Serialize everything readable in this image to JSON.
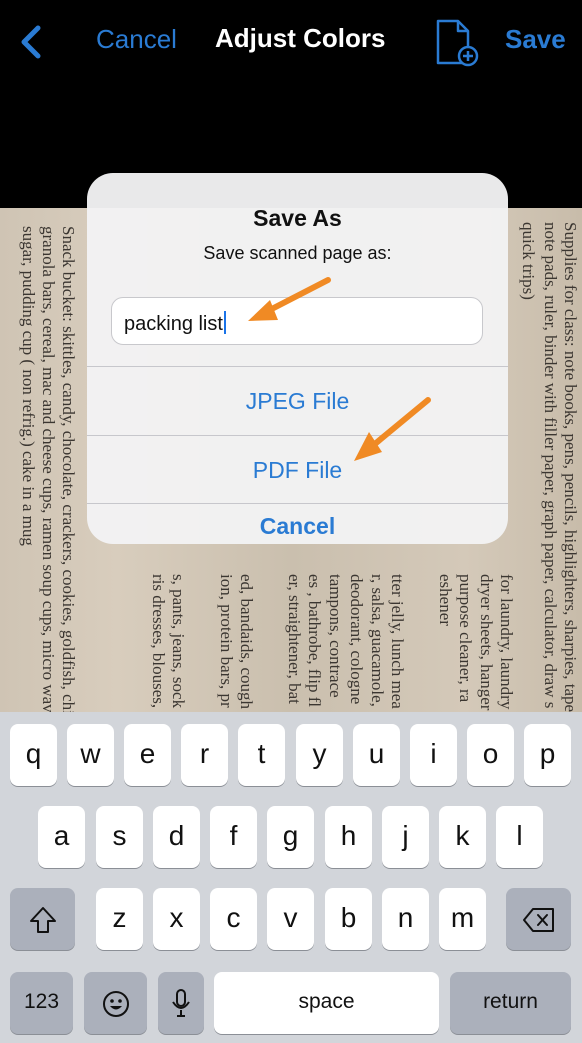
{
  "nav": {
    "cancel": "Cancel",
    "title": "Adjust Colors",
    "save": "Save"
  },
  "scan_lines": [
    "Supplies for class: note books, pens, pencils, highlighters, sharpies, tape,",
    "note pads, ruler, binder with filler paper, graph paper, calculator, draw s",
    "quick trips)",
    "for laundry, laundry",
    "dryer sheets, hanger",
    "purpose cleaner, ra",
    "eshener",
    "tter jelly, lunch mea",
    "r, salsa, guacamole,",
    "deodorant, cologne",
    "tampons, contrace",
    "es , bathrobe, flip fl",
    "er, straightener, bat",
    "ed, bandaids, cough",
    "ion, protein bars, pr",
    "s, pants, jeans, sock",
    "ris dresses, blouses,",
    "Snack bucket: skittles, candy, chocolate, crackers, cookies, goldfish, chips",
    "granola bars, cereal, mac and cheese cups, ramen soup cups, micro wave",
    "sugar, pudding cup ( non refrig.) cake in a mug"
  ],
  "alert": {
    "title": "Save As",
    "message": "Save scanned page as:",
    "filename": "packing list",
    "buttons": [
      "JPEG File",
      "PDF File",
      "Cancel"
    ]
  },
  "keyboard": {
    "row1": [
      "q",
      "w",
      "e",
      "r",
      "t",
      "y",
      "u",
      "i",
      "o",
      "p"
    ],
    "row2": [
      "a",
      "s",
      "d",
      "f",
      "g",
      "h",
      "j",
      "k",
      "l"
    ],
    "row3": [
      "z",
      "x",
      "c",
      "v",
      "b",
      "n",
      "m"
    ],
    "numbers": "123",
    "space": "space",
    "return": "return"
  },
  "colors": {
    "accent": "#2a7bd3",
    "annotation_arrow": "#f08a24",
    "keyboard_bg": "#d2d5da"
  }
}
